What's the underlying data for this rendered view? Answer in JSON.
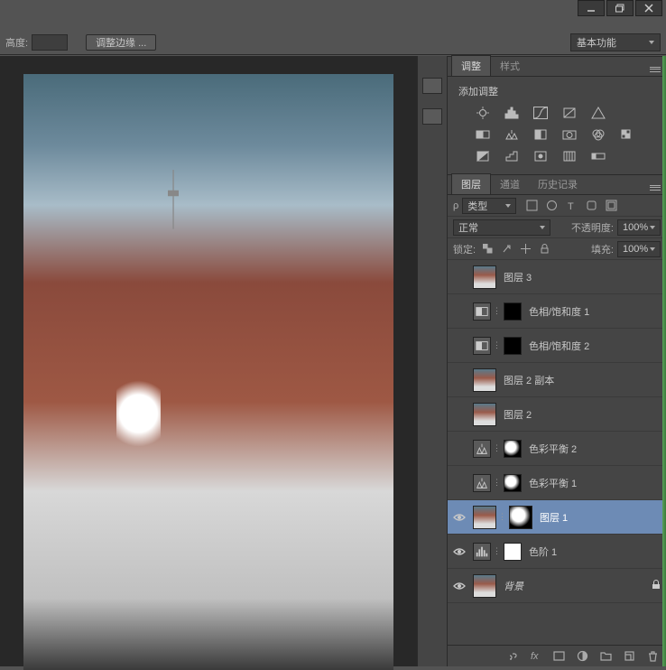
{
  "window": {
    "minimize": "–",
    "restore": "❐",
    "close": "✕"
  },
  "options": {
    "height_label": "高度:",
    "refine_edge": "调整边缘 ...",
    "workspace": "基本功能"
  },
  "adjustments": {
    "tab_adjust": "调整",
    "tab_style": "样式",
    "title": "添加调整"
  },
  "layers_panel": {
    "tab_layers": "图层",
    "tab_channels": "通道",
    "tab_history": "历史记录",
    "kind_label": "类型",
    "blend_mode": "正常",
    "opacity_label": "不透明度:",
    "opacity_value": "100%",
    "lock_label": "锁定:",
    "fill_label": "填充:",
    "fill_value": "100%"
  },
  "layers": [
    {
      "name": "图层 3",
      "type": "image",
      "visible": false,
      "selected": false
    },
    {
      "name": "色相/饱和度 1",
      "type": "adj",
      "adj_icon": "hsl",
      "mask": "black",
      "visible": false,
      "selected": false
    },
    {
      "name": "色相/饱和度 2",
      "type": "adj",
      "adj_icon": "hsl",
      "mask": "black",
      "visible": false,
      "selected": false
    },
    {
      "name": "图层 2 副本",
      "type": "image",
      "visible": false,
      "selected": false
    },
    {
      "name": "图层 2",
      "type": "image",
      "visible": false,
      "selected": false
    },
    {
      "name": "色彩平衡 2",
      "type": "adj",
      "adj_icon": "balance",
      "mask": "mix",
      "visible": false,
      "selected": false
    },
    {
      "name": "色彩平衡 1",
      "type": "adj",
      "adj_icon": "balance",
      "mask": "mix",
      "visible": false,
      "selected": false
    },
    {
      "name": "图层 1",
      "type": "image",
      "mask": "mix",
      "visible": true,
      "selected": true
    },
    {
      "name": "色阶 1",
      "type": "adj",
      "adj_icon": "levels",
      "mask": "white",
      "visible": true,
      "selected": false
    },
    {
      "name": "背景",
      "type": "image",
      "visible": true,
      "selected": false,
      "locked": true,
      "bg": true
    }
  ]
}
